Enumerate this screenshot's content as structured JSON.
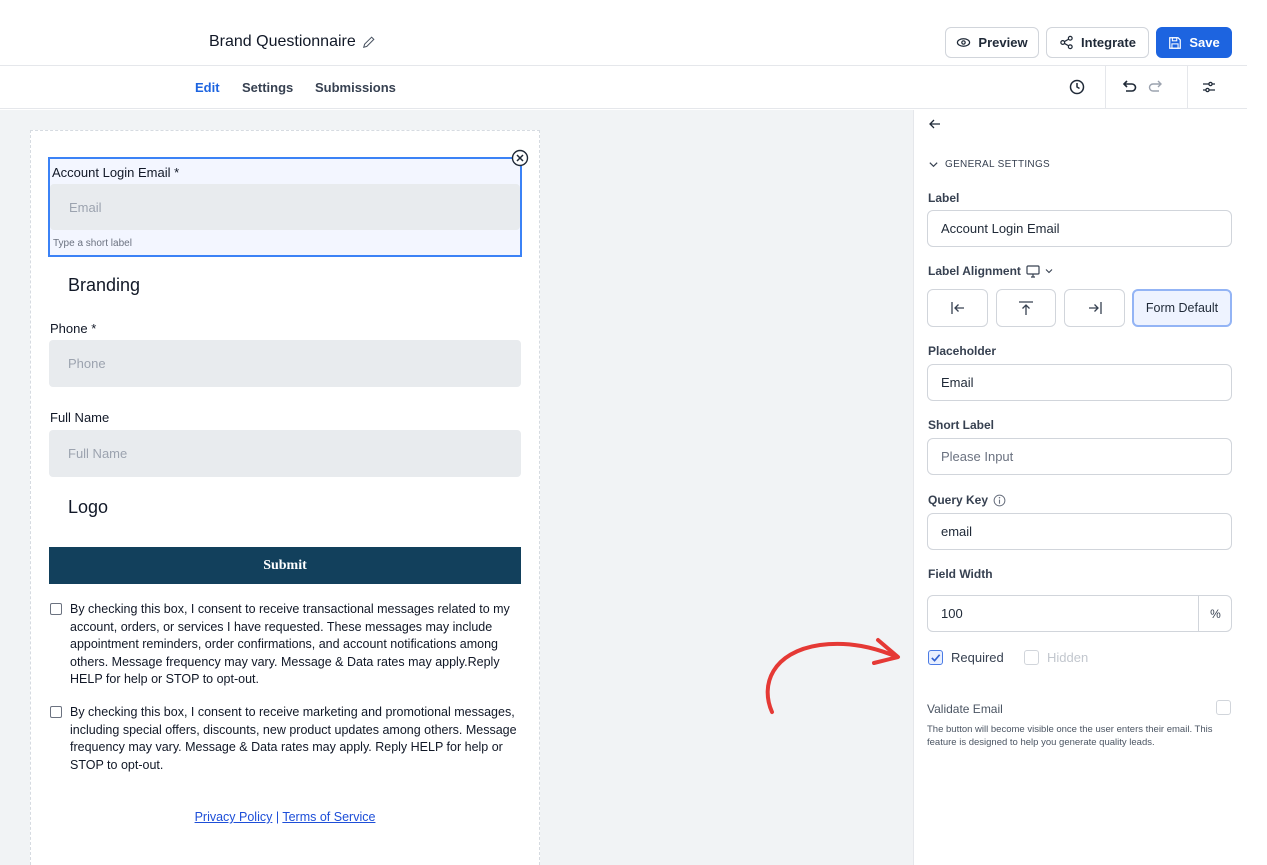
{
  "header": {
    "title": "Brand Questionnaire",
    "preview_label": "Preview",
    "integrate_label": "Integrate",
    "save_label": "Save"
  },
  "tabs": [
    "Edit",
    "Settings",
    "Submissions"
  ],
  "toolbar_icons": [
    "history-icon",
    "undo-icon",
    "redo-icon",
    "settings-sliders-icon"
  ],
  "form": {
    "selected_field": {
      "label": "Account Login Email *",
      "placeholder": "Email",
      "short_label": "Type a short label"
    },
    "branding_heading": "Branding",
    "phone": {
      "label": "Phone *",
      "placeholder": "Phone"
    },
    "full_name": {
      "label": "Full Name",
      "placeholder": "Full Name"
    },
    "logo_heading": "Logo",
    "submit_label": "Submit",
    "consent_1": "By checking this box, I consent to receive transactional messages related to my account, orders, or services I have requested. These messages may include appointment reminders, order confirmations, and account notifications among others. Message frequency may vary. Message & Data rates may apply.Reply HELP for help or STOP to opt-out.",
    "consent_2": "By checking this box, I consent to receive marketing and promotional messages, including special offers, discounts, new product updates among others. Message frequency may vary. Message & Data rates may apply. Reply HELP for help or STOP to opt-out.",
    "privacy_label": "Privacy Policy",
    "separator": "|",
    "terms_label": "Terms of Service"
  },
  "panel": {
    "section_title": "GENERAL SETTINGS",
    "label_title": "Label",
    "label_value": "Account Login Email",
    "alignment_title": "Label Alignment",
    "alignment_options": [
      "left",
      "top",
      "right",
      "Form Default"
    ],
    "alignment_selected": "Form Default",
    "placeholder_title": "Placeholder",
    "placeholder_value": "Email",
    "short_label_title": "Short Label",
    "short_label_placeholder": "Please Input",
    "query_key_title": "Query Key",
    "query_key_value": "email",
    "field_width_title": "Field Width",
    "field_width_value": "100",
    "field_width_unit": "%",
    "required_label": "Required",
    "required_checked": true,
    "hidden_label": "Hidden",
    "hidden_checked": false,
    "validate_email_label": "Validate Email",
    "validate_email_checked": false,
    "validate_email_desc": "The button will become visible once the user enters their email. This feature is designed to help you generate quality leads."
  },
  "colors": {
    "accent": "#1d64e0",
    "submit_bg": "#12405c",
    "annotation_arrow": "#e53935"
  }
}
